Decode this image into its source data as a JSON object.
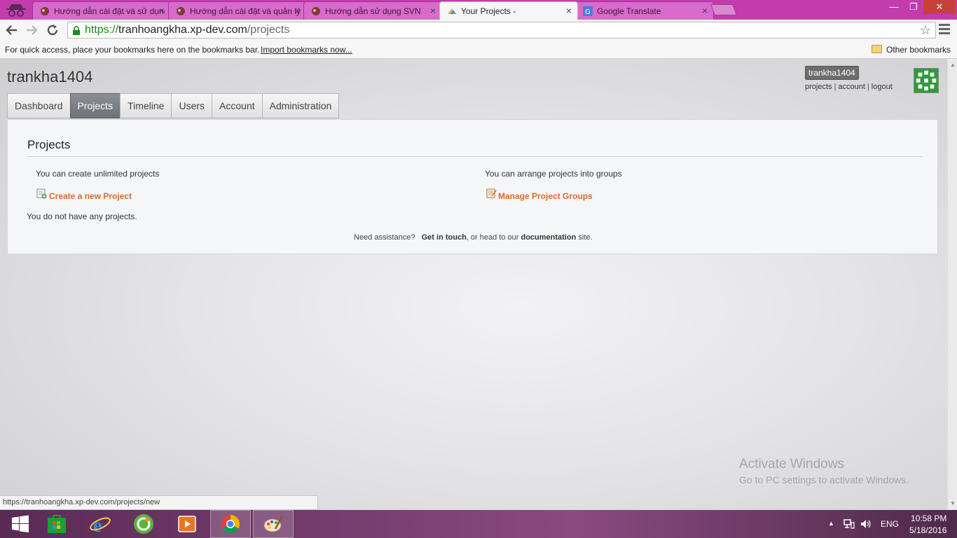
{
  "browser": {
    "tabs": [
      {
        "label": "Hướng dẫn cài đặt và sử dụng",
        "active": false
      },
      {
        "label": "Hướng dẫn cài đặt và quản lý",
        "active": false
      },
      {
        "label": "Hướng dẫn sử dụng SVN",
        "active": false
      },
      {
        "label": "Your Projects -",
        "active": true
      },
      {
        "label": "Google Translate",
        "active": false
      }
    ],
    "close_glyph": "×",
    "window_buttons": {
      "minimize": "—",
      "restore": "❐",
      "close": "✕"
    },
    "url": {
      "scheme": "https://",
      "host": "tranhoangkha.xp-dev.com",
      "path": "/projects"
    },
    "bookmarks_bar": {
      "hint": "For quick access, place your bookmarks here on the bookmarks bar.",
      "import_link": "Import bookmarks now...",
      "other_bookmarks": "Other bookmarks"
    },
    "status_url": "https://tranhoangkha.xp-dev.com/projects/new"
  },
  "page": {
    "site_user": "trankha1404",
    "user_badge": "trankha1404",
    "user_links": [
      "projects",
      "account",
      "logout"
    ],
    "nav_tabs": [
      {
        "label": "Dashboard",
        "active": false
      },
      {
        "label": "Projects",
        "active": true
      },
      {
        "label": "Timeline",
        "active": false
      },
      {
        "label": "Users",
        "active": false
      },
      {
        "label": "Account",
        "active": false
      },
      {
        "label": "Administration",
        "active": false
      }
    ],
    "panel": {
      "title": "Projects",
      "left_text": "You can create unlimited projects",
      "left_link": "Create a new Project",
      "right_text": "You can arrange projects into groups",
      "right_link": "Manage Project Groups",
      "empty_message": "You do not have any projects.",
      "help": {
        "prefix": "Need assistance?",
        "contact": "Get in touch",
        "middle": ", or head to our",
        "docs": "documentation",
        "suffix": "site."
      }
    },
    "watermark": {
      "title": "Activate Windows",
      "subtitle": "Go to PC settings to activate Windows."
    }
  },
  "taskbar": {
    "apps": [
      "windows-start-icon",
      "store-icon",
      "internet-explorer-icon",
      "coccoc-browser-icon",
      "media-player-icon",
      "chrome-icon",
      "paint-icon"
    ],
    "language": "ENG",
    "time": "10:58 PM",
    "date": "5/18/2016"
  },
  "colors": {
    "titlebar": "#c23cae",
    "link_orange": "#e0682a",
    "active_tab": "#6e7176"
  }
}
